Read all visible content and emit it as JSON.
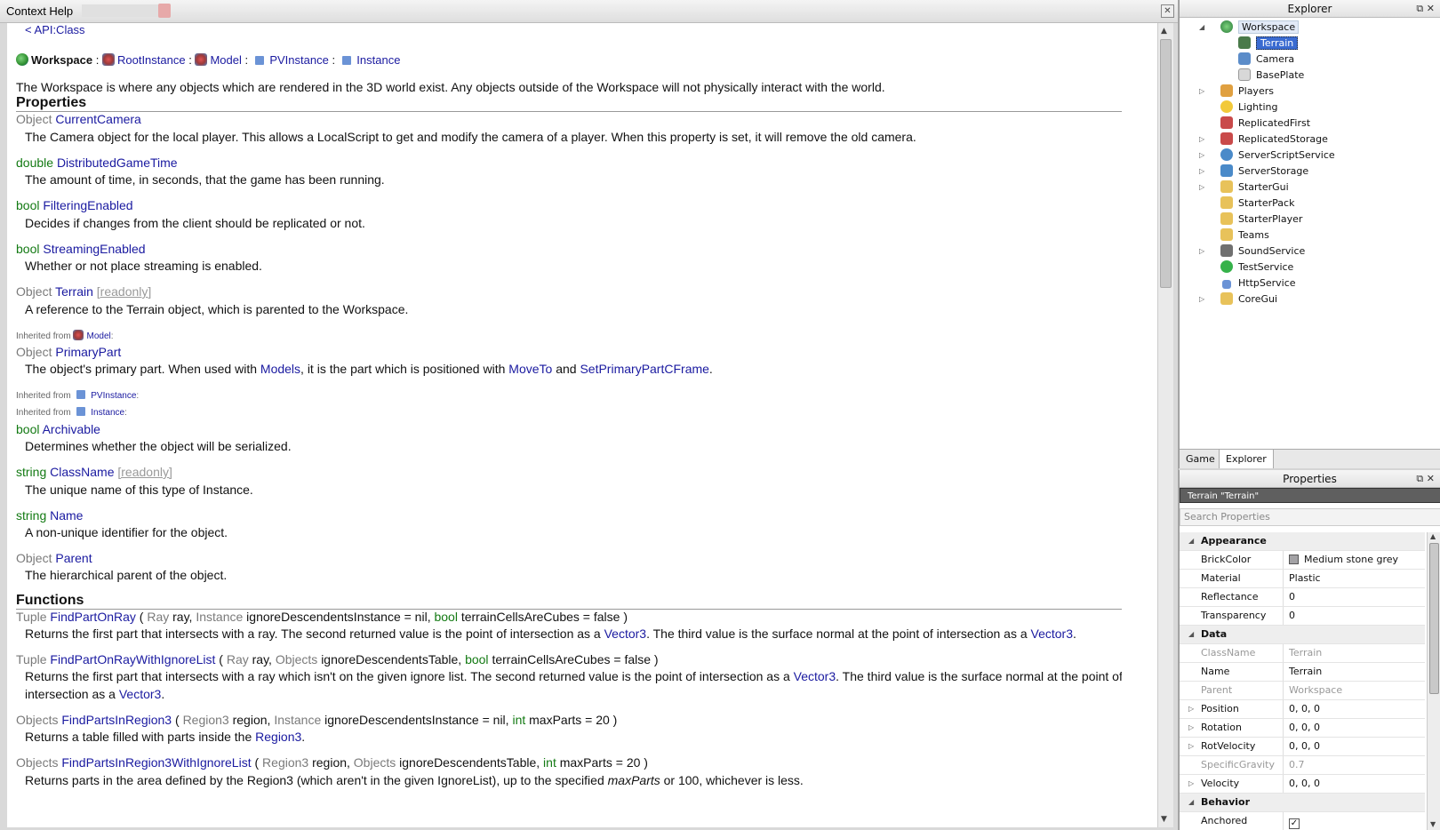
{
  "help": {
    "title": "Context Help",
    "breadcrumb": "< API:Class",
    "class_path": [
      "Workspace",
      "RootInstance",
      "Model",
      "PVInstance",
      "Instance"
    ],
    "summary": "The Workspace is where any objects which are rendered in the 3D world exist. Any objects outside of the Workspace will not physically interact with the world.",
    "sections": {
      "properties": "Properties",
      "functions": "Functions"
    },
    "properties": [
      {
        "type": "Object",
        "name": "CurrentCamera",
        "desc": "The Camera object for the local player. This allows a LocalScript to get and modify the camera of a player. When this property is set, it will remove the old camera."
      },
      {
        "type": "double",
        "name": "DistributedGameTime",
        "desc": "The amount of time, in seconds, that the game has been running."
      },
      {
        "type": "bool",
        "name": "FilteringEnabled",
        "desc": "Decides if changes from the client should be replicated or not."
      },
      {
        "type": "bool",
        "name": "StreamingEnabled",
        "desc": "Whether or not place streaming is enabled."
      },
      {
        "type": "Object",
        "name": "Terrain",
        "readonly": "[readonly]",
        "desc": "A reference to the Terrain object, which is parented to the Workspace."
      }
    ],
    "inherited_model_label": "Inherited from",
    "inherited_model": "Model",
    "primary_part": {
      "type": "Object",
      "name": "PrimaryPart",
      "desc_a": "The object's primary part. When used with ",
      "link1": "Models",
      "desc_b": ", it is the part which is positioned with ",
      "link2": "MoveTo",
      "desc_c": " and ",
      "link3": "SetPrimaryPartCFrame",
      "desc_d": "."
    },
    "inherited_pv": "PVInstance",
    "inherited_inst": "Instance",
    "inst_props": [
      {
        "type": "bool",
        "name": "Archivable",
        "desc": "Determines whether the object will be serialized."
      },
      {
        "type": "string",
        "name": "ClassName",
        "readonly": "[readonly]",
        "desc": "The unique name of this type of Instance."
      },
      {
        "type": "string",
        "name": "Name",
        "desc": "A non-unique identifier for the object."
      },
      {
        "type": "Object",
        "name": "Parent",
        "desc": "The hierarchical parent of the object."
      }
    ],
    "functions": {
      "f1": {
        "ret": "Tuple",
        "name": "FindPartOnRay",
        "sig_open": "(",
        "a1t": "Ray",
        "a1n": "ray,",
        "a2t": "Instance",
        "a2n": "ignoreDescendentsInstance = nil,",
        "a3t": "bool",
        "a3n": "terrainCellsAreCubes = false )",
        "d1": "Returns the first part that intersects with a ray. The second returned value is the point of intersection as a ",
        "l1": "Vector3",
        "d2": ". The third value is the surface normal at the point of intersection as a ",
        "l2": "Vector3",
        "d3": "."
      },
      "f2": {
        "ret": "Tuple",
        "name": "FindPartOnRayWithIgnoreList",
        "sig_open": "(",
        "a1t": "Ray",
        "a1n": "ray,",
        "a2t": "Objects",
        "a2n": "ignoreDescendentsTable,",
        "a3t": "bool",
        "a3n": "terrainCellsAreCubes = false )",
        "d1": "Returns the first part that intersects with a ray which isn't on the given ignore list. The second returned value is the point of intersection as a ",
        "l1": "Vector3",
        "d2": ". The third value is the surface normal at the point of",
        "d3": "intersection as a ",
        "l2": "Vector3",
        "d4": "."
      },
      "f3": {
        "ret": "Objects",
        "name": "FindPartsInRegion3",
        "sig_open": "(",
        "a1t": "Region3",
        "a1n": "region,",
        "a2t": "Instance",
        "a2n": "ignoreDescendentsInstance = nil,",
        "a3t": "int",
        "a3n": "maxParts = 20 )",
        "d1": "Returns a table filled with parts inside the ",
        "l1": "Region3",
        "d2": "."
      },
      "f4": {
        "ret": "Objects",
        "name": "FindPartsInRegion3WithIgnoreList",
        "sig_open": "(",
        "a1t": "Region3",
        "a1n": "region,",
        "a2t": "Objects",
        "a2n": "ignoreDescendentsTable,",
        "a3t": "int",
        "a3n": "maxParts = 20 )",
        "d1": "Returns parts in the area defined by the Region3 (which aren't in the given IgnoreList), up to the specified ",
        "em": "maxParts",
        "d2": " or 100, whichever is less."
      }
    }
  },
  "explorer": {
    "title": "Explorer",
    "items": [
      "Workspace",
      "Terrain",
      "Camera",
      "BasePlate",
      "Players",
      "Lighting",
      "ReplicatedFirst",
      "ReplicatedStorage",
      "ServerScriptService",
      "ServerStorage",
      "StarterGui",
      "StarterPack",
      "StarterPlayer",
      "Teams",
      "SoundService",
      "TestService",
      "HttpService",
      "CoreGui"
    ],
    "tabs": [
      "Game",
      "Explorer"
    ]
  },
  "properties_panel": {
    "title": "Properties",
    "selection": "Terrain \"Terrain\"",
    "search_placeholder": "Search Properties",
    "rows": [
      {
        "cat": "Appearance"
      },
      {
        "k": "BrickColor",
        "v": "Medium stone grey"
      },
      {
        "k": "Material",
        "v": "Plastic"
      },
      {
        "k": "Reflectance",
        "v": "0"
      },
      {
        "k": "Transparency",
        "v": "0"
      },
      {
        "cat": "Data"
      },
      {
        "k": "ClassName",
        "v": "Terrain"
      },
      {
        "k": "Name",
        "v": "Terrain"
      },
      {
        "k": "Parent",
        "v": "Workspace"
      },
      {
        "k": "Position",
        "v": "0, 0, 0"
      },
      {
        "k": "Rotation",
        "v": "0, 0, 0"
      },
      {
        "k": "RotVelocity",
        "v": "0, 0, 0"
      },
      {
        "k": "SpecificGravity",
        "v": "0.7"
      },
      {
        "k": "Velocity",
        "v": "0, 0, 0"
      },
      {
        "cat": "Behavior"
      },
      {
        "k": "Anchored",
        "v": "✓"
      }
    ],
    "brickcolor_hex": "#a3a2a5"
  }
}
